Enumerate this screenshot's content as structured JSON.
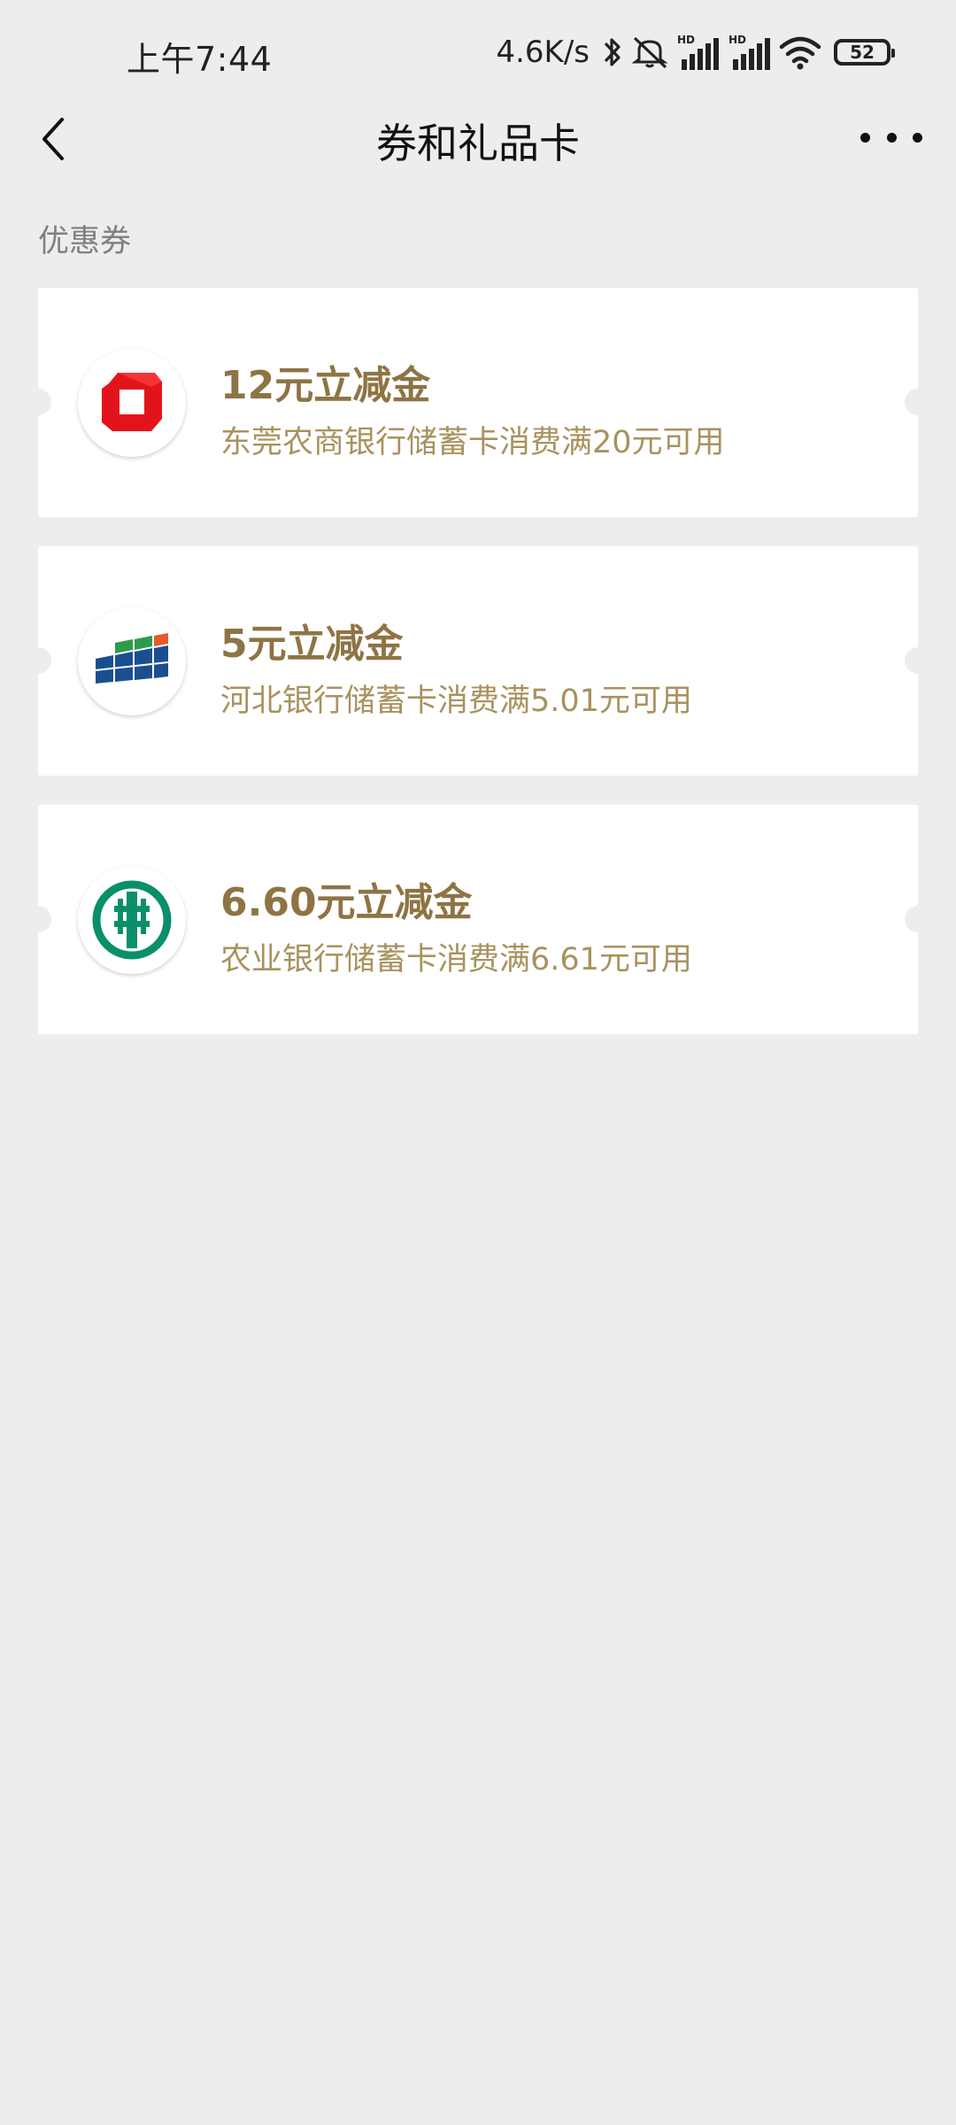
{
  "status_bar": {
    "time": "上午7:44",
    "net_speed": "4.6K/s",
    "battery": "52"
  },
  "nav": {
    "title": "券和礼品卡"
  },
  "section": {
    "title": "优惠券"
  },
  "coupons": [
    {
      "amount": "12元立减金",
      "desc": "东莞农商银行储蓄卡消费满20元可用",
      "logo_icon": "dongguan-rural-bank-logo-icon"
    },
    {
      "amount": "5元立减金",
      "desc": "河北银行储蓄卡消费满5.01元可用",
      "logo_icon": "hebei-bank-logo-icon"
    },
    {
      "amount": "6.60元立减金",
      "desc": "农业银行储蓄卡消费满6.61元可用",
      "logo_icon": "agricultural-bank-logo-icon"
    }
  ],
  "colors": {
    "background": "#ededed",
    "card": "#ffffff",
    "amount_text": "#8e7444",
    "desc_text": "#a9925f"
  }
}
